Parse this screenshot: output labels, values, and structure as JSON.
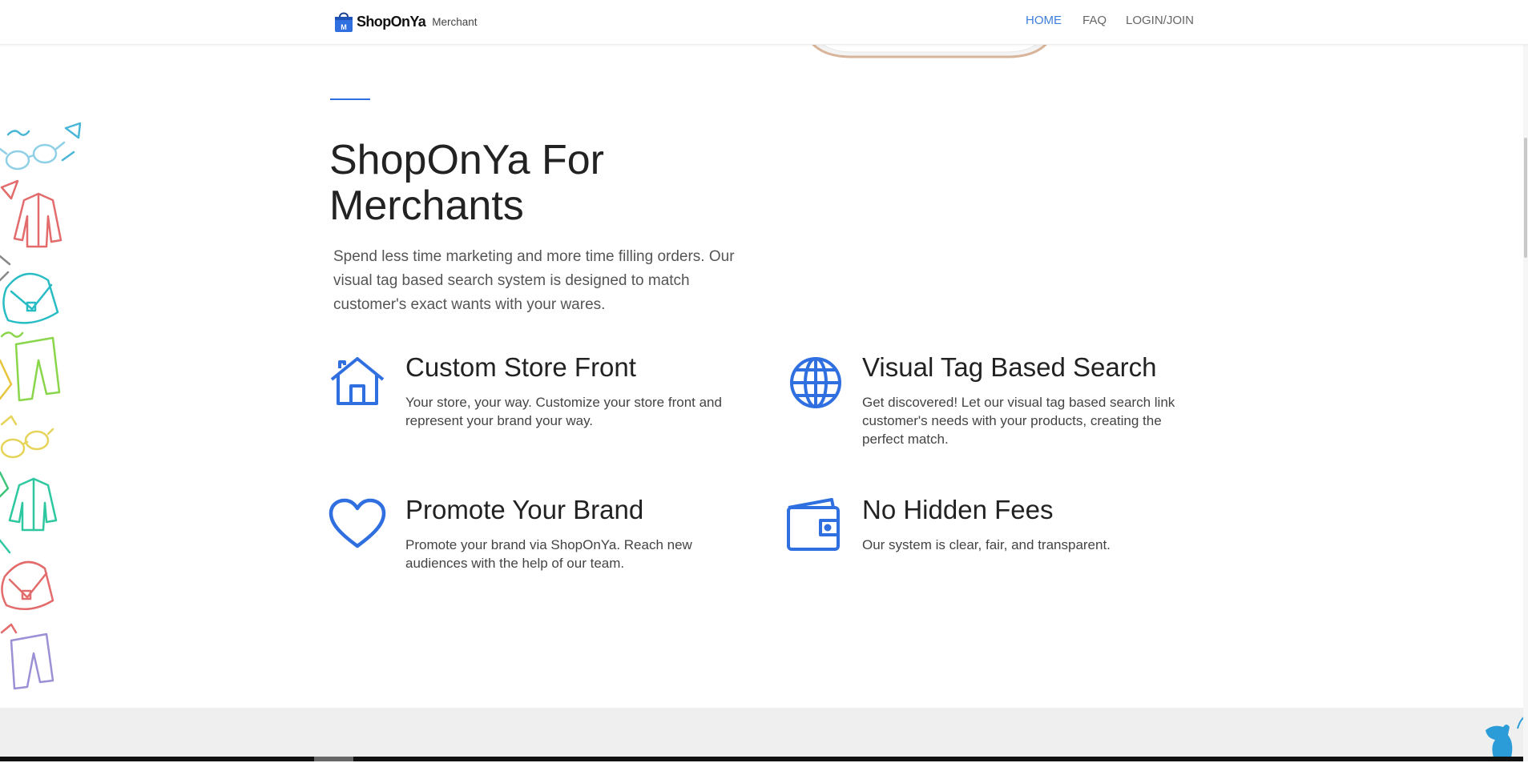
{
  "brand": {
    "name": "ShopOnYa",
    "suffix": "Merchant",
    "accent_color": "#2f6fe0"
  },
  "nav": {
    "items": [
      {
        "label": "HOME",
        "active": true
      },
      {
        "label": "FAQ",
        "active": false
      },
      {
        "label": "LOGIN/JOIN",
        "active": false
      }
    ]
  },
  "hero": {
    "title_line1": "ShopOnYa For",
    "title_line2": "Merchants",
    "lead": "Spend less time marketing and more time filling orders. Our visual tag based search system is designed to match customer's exact wants with your wares."
  },
  "features": [
    {
      "icon": "house-icon",
      "title": "Custom Store Front",
      "description": "Your store, your way. Customize your store front and represent your brand your way."
    },
    {
      "icon": "globe-icon",
      "title": "Visual Tag Based Search",
      "description": "Get discovered! Let our visual tag based search link customer's needs with your products, creating the perfect match."
    },
    {
      "icon": "heart-icon",
      "title": "Promote Your Brand",
      "description": "Promote your brand via ShopOnYa. Reach new audiences with the help of our team."
    },
    {
      "icon": "wallet-icon",
      "title": "No Hidden Fees",
      "description": "Our system is clear, fair, and transparent."
    }
  ]
}
